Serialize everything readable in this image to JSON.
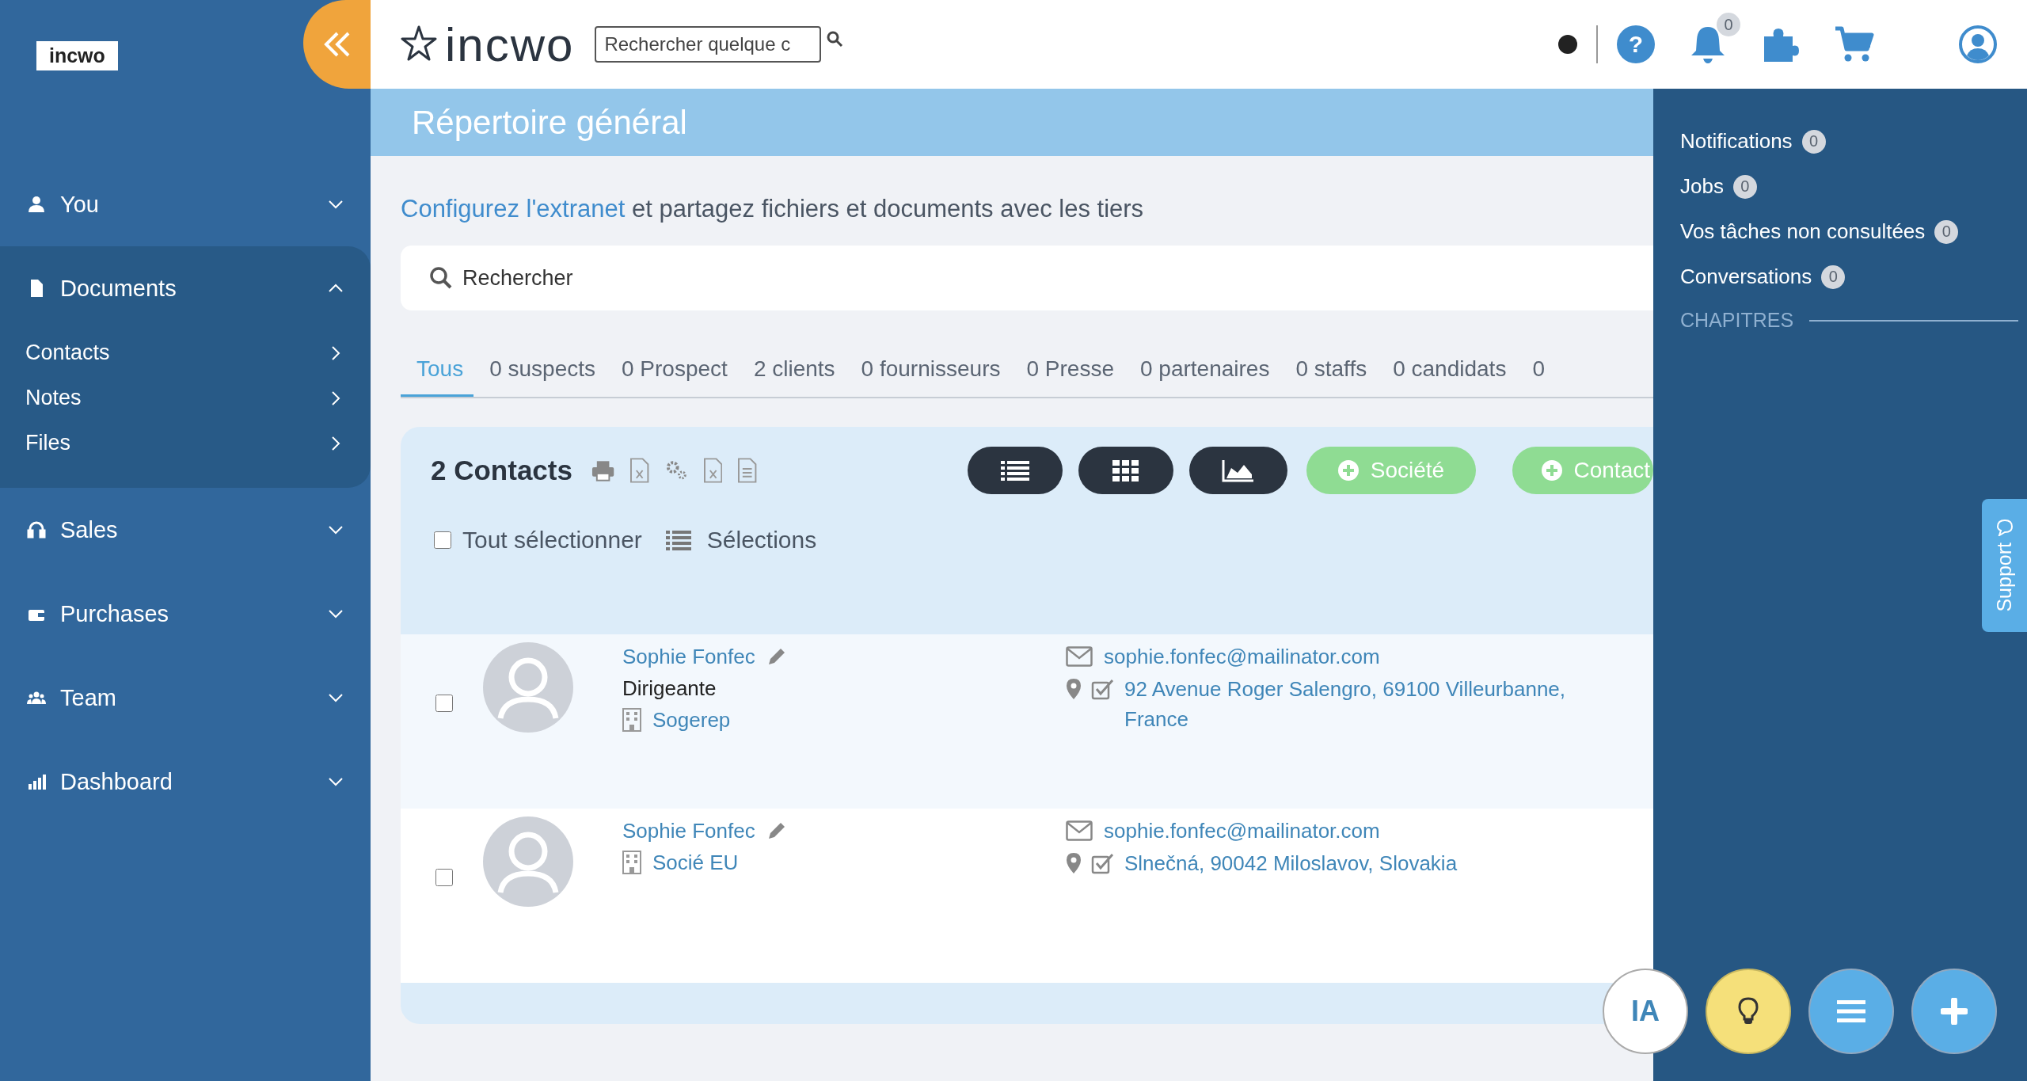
{
  "sidebar": {
    "logo": "incwo",
    "items": [
      {
        "label": "You",
        "expanded": false
      },
      {
        "label": "Documents",
        "expanded": true,
        "children": [
          {
            "label": "Contacts"
          },
          {
            "label": "Notes"
          },
          {
            "label": "Files"
          }
        ]
      },
      {
        "label": "Sales",
        "expanded": false
      },
      {
        "label": "Purchases",
        "expanded": false
      },
      {
        "label": "Team",
        "expanded": false
      },
      {
        "label": "Dashboard",
        "expanded": false
      }
    ]
  },
  "header": {
    "logo": "incwo",
    "help": "?",
    "search_placeholder": "Rechercher quelque c",
    "notification_count": "0"
  },
  "page_title": "Répertoire général",
  "extranet": {
    "link": "Configurez l'extranet",
    "text": "et partagez fichiers et documents avec les tiers"
  },
  "search": {
    "placeholder": "Rechercher"
  },
  "tabs": [
    {
      "label": "Tous",
      "selected": true
    },
    {
      "label": "0 suspects",
      "selected": false
    },
    {
      "label": "0 Prospect",
      "selected": false
    },
    {
      "label": "2 clients",
      "selected": false
    },
    {
      "label": "0 fournisseurs",
      "selected": false
    },
    {
      "label": "0 Presse",
      "selected": false
    },
    {
      "label": "0 partenaires",
      "selected": false
    },
    {
      "label": "0 staffs",
      "selected": false
    },
    {
      "label": "0 candidats",
      "selected": false
    },
    {
      "label": "0",
      "selected": false
    }
  ],
  "contacts": {
    "title": "2 Contacts",
    "add_buttons": [
      "Société",
      "Contact"
    ],
    "select_all": {
      "label": "Tout sélectionner",
      "checked": false
    },
    "selections": "Sélections",
    "rows": [
      {
        "name": "Sophie Fonfec",
        "role": "Dirigeante",
        "company": "Sogerep",
        "email": "sophie.fonfec@mailinator.com",
        "address": "92 Avenue Roger Salengro, 69100 Villeurbanne, France",
        "checked": false,
        "highlighted": true
      },
      {
        "name": "Sophie Fonfec",
        "company": "Socié EU",
        "email": "sophie.fonfec@mailinator.com",
        "address": "Slnečná, 90042 Miloslavov, Slovakia",
        "checked": false,
        "highlighted": false
      }
    ]
  },
  "right_panel": {
    "items": [
      {
        "label": "Notifications",
        "count": "0"
      },
      {
        "label": "Jobs",
        "count": "0"
      },
      {
        "label": "Vos tâches non consultées",
        "count": "0"
      },
      {
        "label": "Conversations",
        "count": "0"
      }
    ],
    "chapters": "CHAPITRES",
    "support": "Support"
  },
  "fab": {
    "ia": "IA"
  }
}
